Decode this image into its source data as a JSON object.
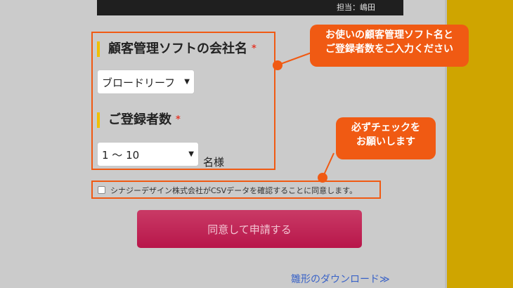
{
  "header": {
    "contact": "担当：嶋田"
  },
  "form": {
    "company_label": "顧客管理ソフトの会社名",
    "company_required": "*",
    "company_select_value": "ブロードリーフ",
    "users_label": "ご登録者数",
    "users_required": "*",
    "users_select_value": "1 〜 10",
    "users_unit": "名様"
  },
  "agreement": {
    "text": "シナジーデザイン株式会社がCSVデータを確認することに同意します。"
  },
  "submit": {
    "label": "同意して申請する"
  },
  "download": {
    "label": "雛形のダウンロード≫"
  },
  "callouts": {
    "top": {
      "line1": "お使いの顧客管理ソフト名と",
      "line2": "ご登録者数をご入力ください"
    },
    "bottom": {
      "line1": "必ずチェックを",
      "line2": "お願いします"
    }
  },
  "colors": {
    "accent": "#f05a13",
    "submit": "#c02052",
    "link": "#3a63c7",
    "stripe": "#cfa500"
  }
}
